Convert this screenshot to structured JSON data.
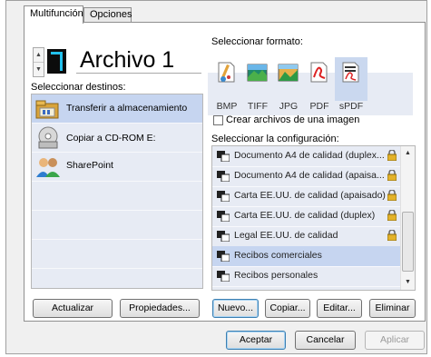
{
  "tabs": [
    {
      "label": "Multifunción"
    },
    {
      "label": "Opciones"
    }
  ],
  "profile": {
    "number": "7",
    "name": "Archivo 1"
  },
  "destinations": {
    "label": "Seleccionar destinos:",
    "items": [
      {
        "label": "Transferir a almacenamiento",
        "icon": "folder-storage-icon",
        "selected": true
      },
      {
        "label": "Copiar a CD-ROM  E:",
        "icon": "cd-rom-icon",
        "selected": false
      },
      {
        "label": "SharePoint",
        "icon": "sharepoint-icon",
        "selected": false
      }
    ]
  },
  "format": {
    "label": "Seleccionar formato:",
    "options": [
      {
        "label": "BMP",
        "icon": "bmp-paint-icon"
      },
      {
        "label": "TIFF",
        "icon": "tiff-image-icon"
      },
      {
        "label": "JPG",
        "icon": "jpg-image-icon"
      },
      {
        "label": "PDF",
        "icon": "pdf-icon"
      },
      {
        "label": "sPDF",
        "icon": "searchable-pdf-icon",
        "selected": true
      }
    ]
  },
  "create_files_checkbox": {
    "label": "Crear archivos de una imagen",
    "checked": false
  },
  "configuration": {
    "label": "Seleccionar la configuración:",
    "items": [
      {
        "label": "Documento A4 de calidad (duplex...",
        "locked": true
      },
      {
        "label": "Documento A4 de calidad (apaisa...",
        "locked": true
      },
      {
        "label": "Carta EE.UU. de calidad (apaisado)",
        "locked": true
      },
      {
        "label": "Carta EE.UU. de calidad (duplex)",
        "locked": true
      },
      {
        "label": "Legal EE.UU. de calidad",
        "locked": true
      },
      {
        "label": "Recibos comerciales",
        "locked": false,
        "selected": true
      },
      {
        "label": "Recibos personales",
        "locked": false
      }
    ]
  },
  "buttons": {
    "actualizar": "Actualizar",
    "propiedades": "Propiedades...",
    "nuevo": "Nuevo...",
    "copiar": "Copiar...",
    "editar": "Editar...",
    "eliminar": "Eliminar",
    "aceptar": "Aceptar",
    "cancelar": "Cancelar",
    "aplicar": "Aplicar"
  },
  "colors": {
    "list_background": "#e7ebf4",
    "selected_row": "#c6d5f0",
    "digit_color": "#22c0ec"
  }
}
